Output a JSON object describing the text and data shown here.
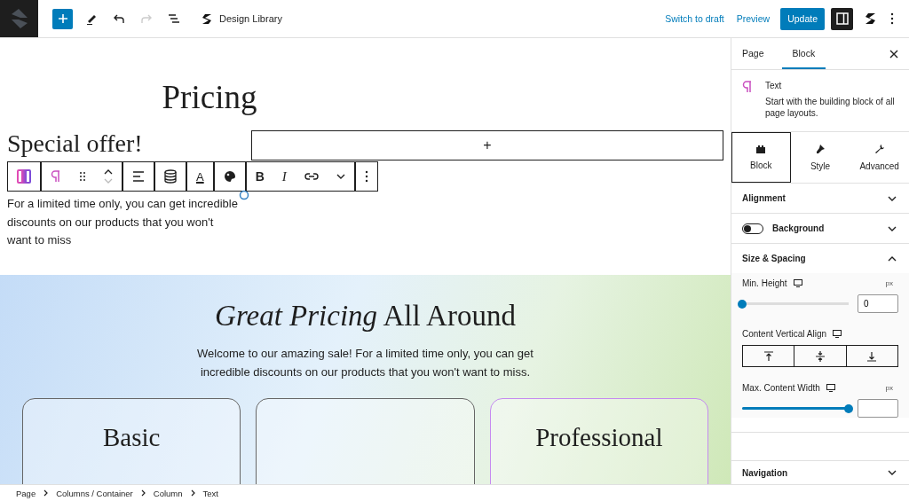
{
  "topbar": {
    "tools": [
      {
        "kind": "add"
      },
      {
        "kind": "edit"
      },
      {
        "kind": "undo"
      },
      {
        "kind": "redo",
        "disabled": true
      },
      {
        "kind": "outline"
      }
    ],
    "document_title": "Design Library",
    "actions": [
      {
        "kind": "link",
        "label": "Switch to draft"
      },
      {
        "kind": "link",
        "label": "Preview"
      },
      {
        "kind": "primary",
        "label": "Update"
      }
    ],
    "settings_open": true
  },
  "canvas": {
    "heading": "Pricing",
    "offer_heading": "Special offer!",
    "appender": "+",
    "block_toolbar": {
      "groups": [
        [
          {
            "kind": "switcher"
          }
        ],
        [
          {
            "kind": "paragraph"
          },
          {
            "kind": "drag"
          },
          {
            "kind": "mover"
          }
        ],
        [
          {
            "kind": "align"
          }
        ],
        [
          {
            "kind": "data"
          }
        ],
        [
          {
            "kind": "text-color",
            "label": "A"
          }
        ],
        [
          {
            "kind": "palette"
          }
        ],
        [
          {
            "kind": "bold",
            "label": "B"
          },
          {
            "kind": "italic",
            "label": "I"
          },
          {
            "kind": "link"
          },
          {
            "kind": "more"
          }
        ],
        [
          {
            "kind": "options"
          }
        ]
      ]
    },
    "paragraph": "For a limited time only, you can get incredible discounts on our products that you won't want to miss",
    "pricing": {
      "title": "*Great Pricing* All Around",
      "intro": "Welcome to our amazing sale! For a limited time only, you can get incredible discounts on our products that you won't want to miss.",
      "plans": [
        {
          "name": "Basic",
          "highlighted": false
        },
        {
          "highlighted": false
        },
        {
          "name": "Professional",
          "highlighted": true
        }
      ]
    }
  },
  "sidebar": {
    "tabs": [
      {
        "label": "Page",
        "selected": false
      },
      {
        "label": "Block",
        "selected": true
      }
    ],
    "block": {
      "name": "Text",
      "description": "Start with the building block of all page layouts."
    },
    "panel_tabs": [
      {
        "kind": "block",
        "label": "Block",
        "selected": true
      },
      {
        "kind": "style",
        "label": "Style",
        "selected": false
      },
      {
        "kind": "advanced",
        "label": "Advanced",
        "selected": false
      }
    ],
    "sections": [
      {
        "kind": "panel",
        "title": "Alignment",
        "expanded": false
      },
      {
        "kind": "toggle",
        "title": "Background",
        "on": false,
        "expanded": false
      },
      {
        "kind": "panel",
        "title": "Size & Spacing",
        "expanded": true,
        "controls": [
          {
            "kind": "slider",
            "label": "Min. Height",
            "unit": "px",
            "level": 0,
            "value": "0"
          },
          {
            "kind": "align",
            "label": "Content Vertical Align"
          },
          {
            "kind": "slider",
            "label": "Max. Content Width",
            "unit": "px",
            "level": 1
          }
        ]
      }
    ],
    "footer_panel": {
      "title": "Navigation",
      "expanded": false
    }
  },
  "breadcrumbs": [
    "Page",
    "Columns / Container",
    "Column",
    "Text"
  ]
}
